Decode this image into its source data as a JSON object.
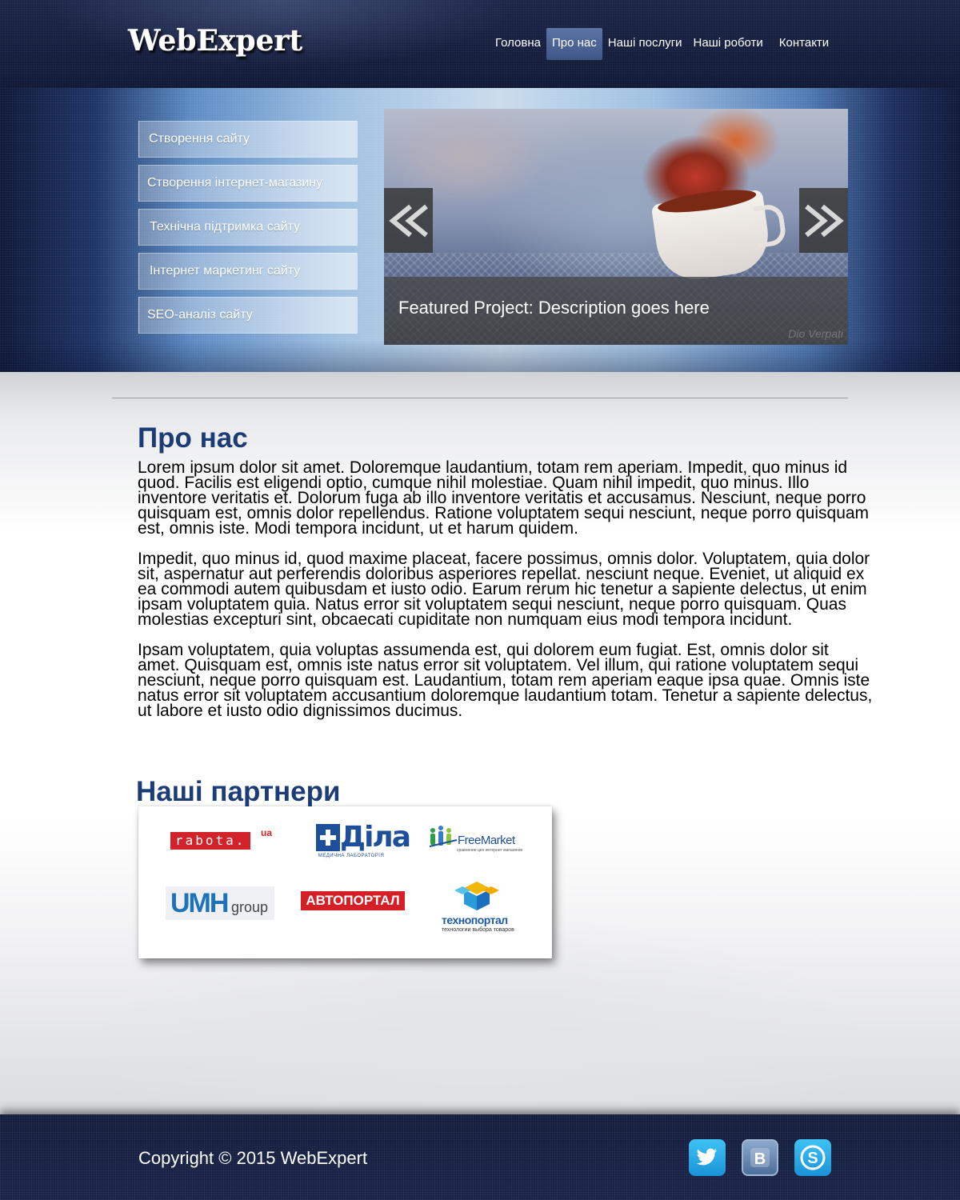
{
  "header": {
    "logo": "WebExpert",
    "nav": [
      {
        "label": "Головна",
        "active": false
      },
      {
        "label": "Про нас",
        "active": true
      },
      {
        "label": "Наші послуги",
        "active": false
      },
      {
        "label": "Наші роботи",
        "active": false
      },
      {
        "label": "Контакти",
        "active": false
      }
    ]
  },
  "services": [
    "Створення сайту",
    "Створення інтернет-магазину",
    "Технічна підтримка сайту",
    "Інтернет маркетинг сайту",
    "SEO-аналіз сайту"
  ],
  "slider": {
    "caption": "Featured Project: Description goes here",
    "watermark": "Dio Verpati",
    "prev_icon": "double-chevron-left-icon",
    "next_icon": "double-chevron-right-icon"
  },
  "about": {
    "title": "Про нас",
    "paragraphs": [
      "Lorem ipsum dolor sit amet. Doloremque laudantium, totam rem aperiam. Impedit, quo minus id quod. Facilis est eligendi optio, cumque nihil molestiae. Quam nihil impedit, quo minus. Illo inventore veritatis et. Dolorum fuga ab illo inventore veritatis et accusamus. Nesciunt, neque porro quisquam est, omnis dolor repellendus. Ratione voluptatem sequi nesciunt, neque porro quisquam est, omnis iste. Modi tempora incidunt, ut et harum quidem.",
      "Impedit, quo minus id, quod maxime placeat, facere possimus, omnis dolor. Voluptatem, quia dolor sit, aspernatur aut perferendis doloribus asperiores repellat. nesciunt neque. Eveniet, ut aliquid ex ea commodi autem quibusdam et iusto odio. Earum rerum hic tenetur a sapiente delectus, ut enim ipsam voluptatem quia. Natus error sit voluptatem sequi nesciunt, neque porro quisquam. Quas molestias excepturi sint, obcaecati cupiditate non numquam eius modi tempora incidunt.",
      "Ipsam voluptatem, quia voluptas assumenda est, qui dolorem eum fugiat. Est, omnis dolor sit amet. Quisquam est, omnis iste natus error sit voluptatem. Vel illum, qui ratione voluptatem sequi nesciunt, neque porro quisquam est. Laudantium, totam rem aperiam eaque ipsa quae. Omnis iste natus error sit voluptatem accusantium doloremque laudantium totam. Tenetur a sapiente delectus, ut labore et iusto odio dignissimos ducimus."
    ]
  },
  "partners": {
    "title": "Наші партнери",
    "logos": {
      "rabota": "rabota.",
      "rabota_suffix": "ua",
      "dila": "Діла",
      "dila_sub": "МЕДИЧНА ЛАБОРАТОРІЯ",
      "freemarket": "FreeMarket",
      "freemarket_sub": "сравнение цен интернет магазинов",
      "umh": "UMH",
      "umh_group": "group",
      "autoportal": "АВТОПОРТАЛ",
      "technoportal": "технопортал",
      "technoportal_sub": "технологии выбора товаров"
    }
  },
  "footer": {
    "copyright": "Copyright © 2015 WebExpert",
    "social": [
      "twitter-icon",
      "vk-icon",
      "skype-icon"
    ]
  },
  "colors": {
    "heading": "#1c3c78",
    "nav_active": "#4a6294",
    "header_bg": "#1b2547",
    "footer_bg": "#141d3c"
  }
}
